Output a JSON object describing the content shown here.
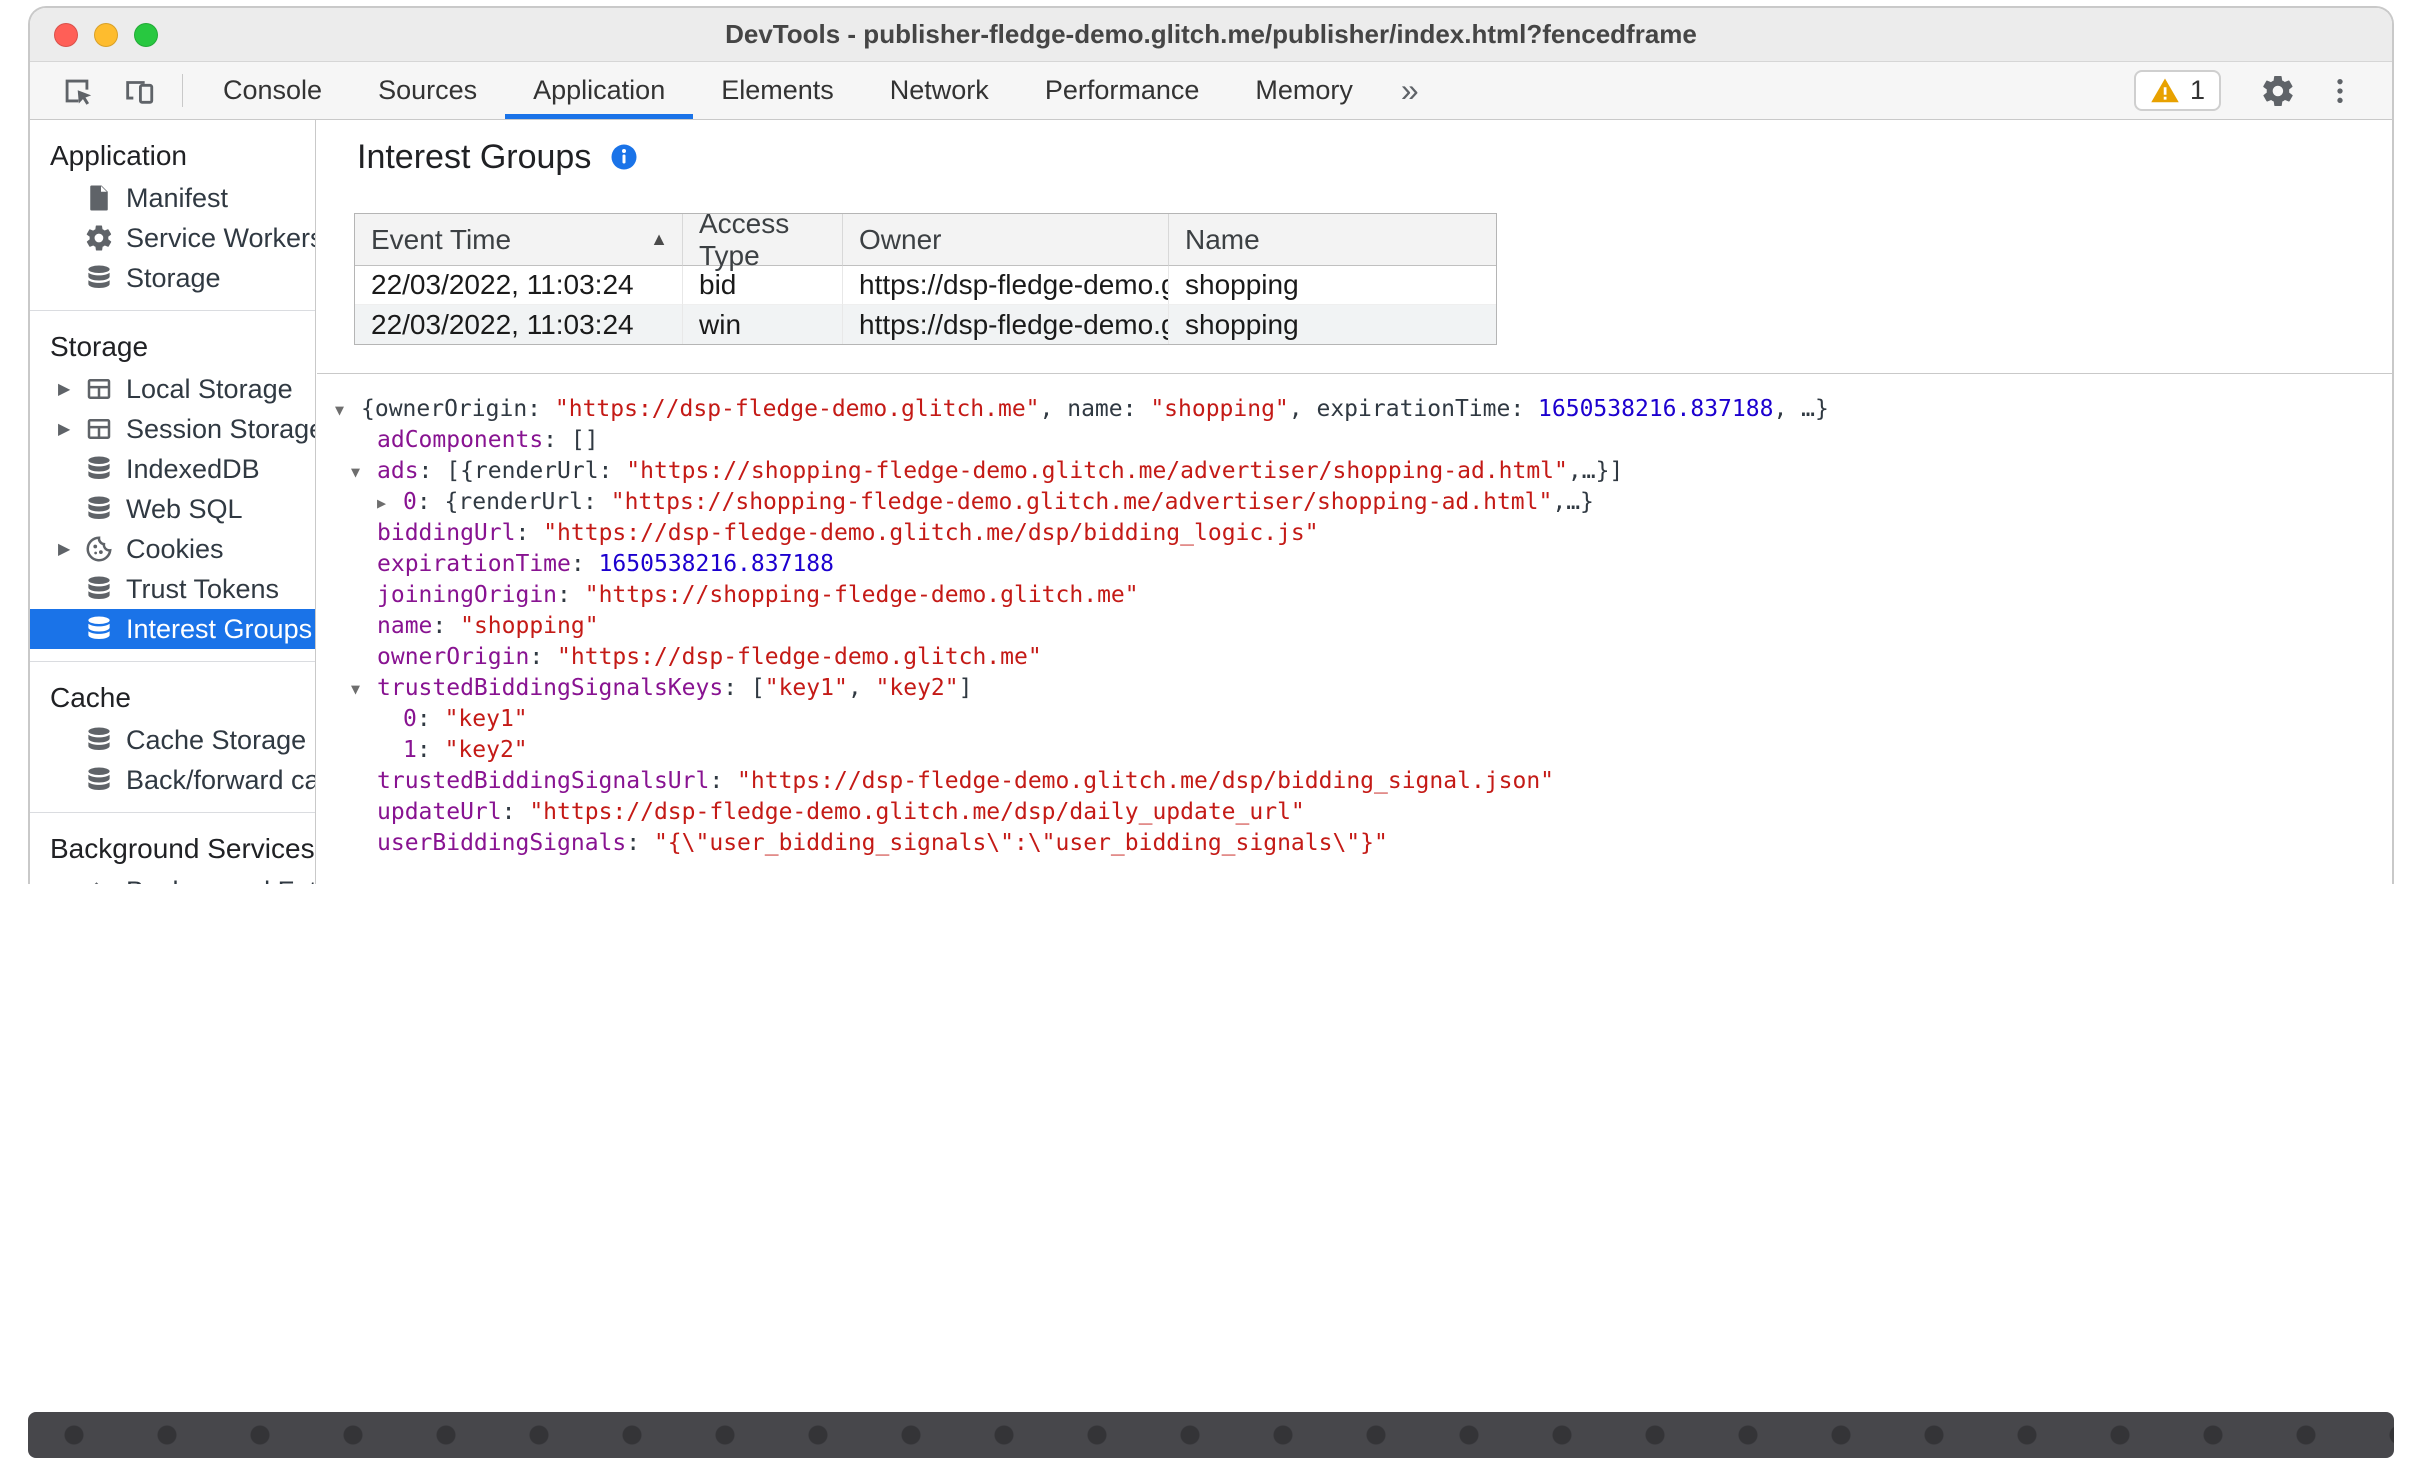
{
  "window": {
    "title": "DevTools - publisher-fledge-demo.glitch.me/publisher/index.html?fencedframe"
  },
  "toolbar": {
    "tabs": [
      "Console",
      "Sources",
      "Application",
      "Elements",
      "Network",
      "Performance",
      "Memory"
    ],
    "active_tab": "Application",
    "more_tabs_label": "»",
    "warning_count": "1"
  },
  "sidebar": {
    "expand_icon": "▶",
    "sections": [
      {
        "header": "Application",
        "items": [
          {
            "label": "Manifest"
          },
          {
            "label": "Service Workers"
          },
          {
            "label": "Storage"
          }
        ]
      },
      {
        "header": "Storage",
        "items": [
          {
            "label": "Local Storage",
            "expandable": true
          },
          {
            "label": "Session Storage",
            "expandable": true
          },
          {
            "label": "IndexedDB"
          },
          {
            "label": "Web SQL"
          },
          {
            "label": "Cookies",
            "expandable": true
          },
          {
            "label": "Trust Tokens"
          },
          {
            "label": "Interest Groups",
            "selected": true
          }
        ]
      },
      {
        "header": "Cache",
        "items": [
          {
            "label": "Cache Storage"
          },
          {
            "label": "Back/forward cache"
          }
        ]
      },
      {
        "header": "Background Services",
        "items": [
          {
            "label": "Background Fetch"
          }
        ]
      }
    ]
  },
  "main": {
    "title": "Interest Groups",
    "table": {
      "columns": [
        "Event Time",
        "Access Type",
        "Owner",
        "Name"
      ],
      "sorted_by": "Event Time",
      "sort_direction": "asc",
      "sort_icon": "▲",
      "rows": [
        {
          "event_time": "22/03/2022, 11:03:24",
          "access_type": "bid",
          "owner": "https://dsp-fledge-demo.gl…",
          "name": "shopping"
        },
        {
          "event_time": "22/03/2022, 11:03:24",
          "access_type": "win",
          "owner": "https://dsp-fledge-demo.gl…",
          "name": "shopping"
        }
      ]
    },
    "tree": {
      "lines": [
        {
          "indent": 0,
          "arrow": "▼",
          "segments": [
            {
              "t": "{ownerOrigin: ",
              "c": "plain"
            },
            {
              "t": "\"https://dsp-fledge-demo.glitch.me\"",
              "c": "str"
            },
            {
              "t": ", name: ",
              "c": "plain"
            },
            {
              "t": "\"shopping\"",
              "c": "str"
            },
            {
              "t": ", expirationTime: ",
              "c": "plain"
            },
            {
              "t": "1650538216.837188",
              "c": "num"
            },
            {
              "t": ", …}",
              "c": "plain"
            }
          ]
        },
        {
          "indent": 16,
          "arrow": "",
          "segments": [
            {
              "t": "adComponents",
              "c": "key"
            },
            {
              "t": ": []",
              "c": "plain"
            }
          ]
        },
        {
          "indent": 16,
          "arrow": "▼",
          "segments": [
            {
              "t": "ads",
              "c": "key"
            },
            {
              "t": ": [{renderUrl: ",
              "c": "plain"
            },
            {
              "t": "\"https://shopping-fledge-demo.glitch.me/advertiser/shopping-ad.html\"",
              "c": "str"
            },
            {
              "t": ",…}]",
              "c": "plain"
            }
          ]
        },
        {
          "indent": 42,
          "arrow": "▶",
          "segments": [
            {
              "t": "0",
              "c": "key"
            },
            {
              "t": ": {renderUrl: ",
              "c": "plain"
            },
            {
              "t": "\"https://shopping-fledge-demo.glitch.me/advertiser/shopping-ad.html\"",
              "c": "str"
            },
            {
              "t": ",…}",
              "c": "plain"
            }
          ]
        },
        {
          "indent": 16,
          "arrow": "",
          "segments": [
            {
              "t": "biddingUrl",
              "c": "key"
            },
            {
              "t": ": ",
              "c": "plain"
            },
            {
              "t": "\"https://dsp-fledge-demo.glitch.me/dsp/bidding_logic.js\"",
              "c": "str"
            }
          ]
        },
        {
          "indent": 16,
          "arrow": "",
          "segments": [
            {
              "t": "expirationTime",
              "c": "key"
            },
            {
              "t": ": ",
              "c": "plain"
            },
            {
              "t": "1650538216.837188",
              "c": "num"
            }
          ]
        },
        {
          "indent": 16,
          "arrow": "",
          "segments": [
            {
              "t": "joiningOrigin",
              "c": "key"
            },
            {
              "t": ": ",
              "c": "plain"
            },
            {
              "t": "\"https://shopping-fledge-demo.glitch.me\"",
              "c": "str"
            }
          ]
        },
        {
          "indent": 16,
          "arrow": "",
          "segments": [
            {
              "t": "name",
              "c": "key"
            },
            {
              "t": ": ",
              "c": "plain"
            },
            {
              "t": "\"shopping\"",
              "c": "str"
            }
          ]
        },
        {
          "indent": 16,
          "arrow": "",
          "segments": [
            {
              "t": "ownerOrigin",
              "c": "key"
            },
            {
              "t": ": ",
              "c": "plain"
            },
            {
              "t": "\"https://dsp-fledge-demo.glitch.me\"",
              "c": "str"
            }
          ]
        },
        {
          "indent": 16,
          "arrow": "▼",
          "segments": [
            {
              "t": "trustedBiddingSignalsKeys",
              "c": "key"
            },
            {
              "t": ": [",
              "c": "plain"
            },
            {
              "t": "\"key1\"",
              "c": "str"
            },
            {
              "t": ", ",
              "c": "plain"
            },
            {
              "t": "\"key2\"",
              "c": "str"
            },
            {
              "t": "]",
              "c": "plain"
            }
          ]
        },
        {
          "indent": 42,
          "arrow": "",
          "segments": [
            {
              "t": "0",
              "c": "key"
            },
            {
              "t": ": ",
              "c": "plain"
            },
            {
              "t": "\"key1\"",
              "c": "str"
            }
          ]
        },
        {
          "indent": 42,
          "arrow": "",
          "segments": [
            {
              "t": "1",
              "c": "key"
            },
            {
              "t": ": ",
              "c": "plain"
            },
            {
              "t": "\"key2\"",
              "c": "str"
            }
          ]
        },
        {
          "indent": 16,
          "arrow": "",
          "segments": [
            {
              "t": "trustedBiddingSignalsUrl",
              "c": "key"
            },
            {
              "t": ": ",
              "c": "plain"
            },
            {
              "t": "\"https://dsp-fledge-demo.glitch.me/dsp/bidding_signal.json\"",
              "c": "str"
            }
          ]
        },
        {
          "indent": 16,
          "arrow": "",
          "segments": [
            {
              "t": "updateUrl",
              "c": "key"
            },
            {
              "t": ": ",
              "c": "plain"
            },
            {
              "t": "\"https://dsp-fledge-demo.glitch.me/dsp/daily_update_url\"",
              "c": "str"
            }
          ]
        },
        {
          "indent": 16,
          "arrow": "",
          "segments": [
            {
              "t": "userBiddingSignals",
              "c": "key"
            },
            {
              "t": ": ",
              "c": "plain"
            },
            {
              "t": "\"{\\\"user_bidding_signals\\\":\\\"user_bidding_signals\\\"}\"",
              "c": "str"
            }
          ]
        }
      ]
    }
  },
  "colors": {
    "accent_blue": "#1a73e8",
    "selected_item_bg": "#1a73e8",
    "json_key": "#881391",
    "json_string": "#c41a16",
    "json_number": "#1c00cf",
    "warning_amber": "#e8a100",
    "traffic_red": "#ff5f57",
    "traffic_yellow": "#febc2e",
    "traffic_green": "#28c840"
  }
}
